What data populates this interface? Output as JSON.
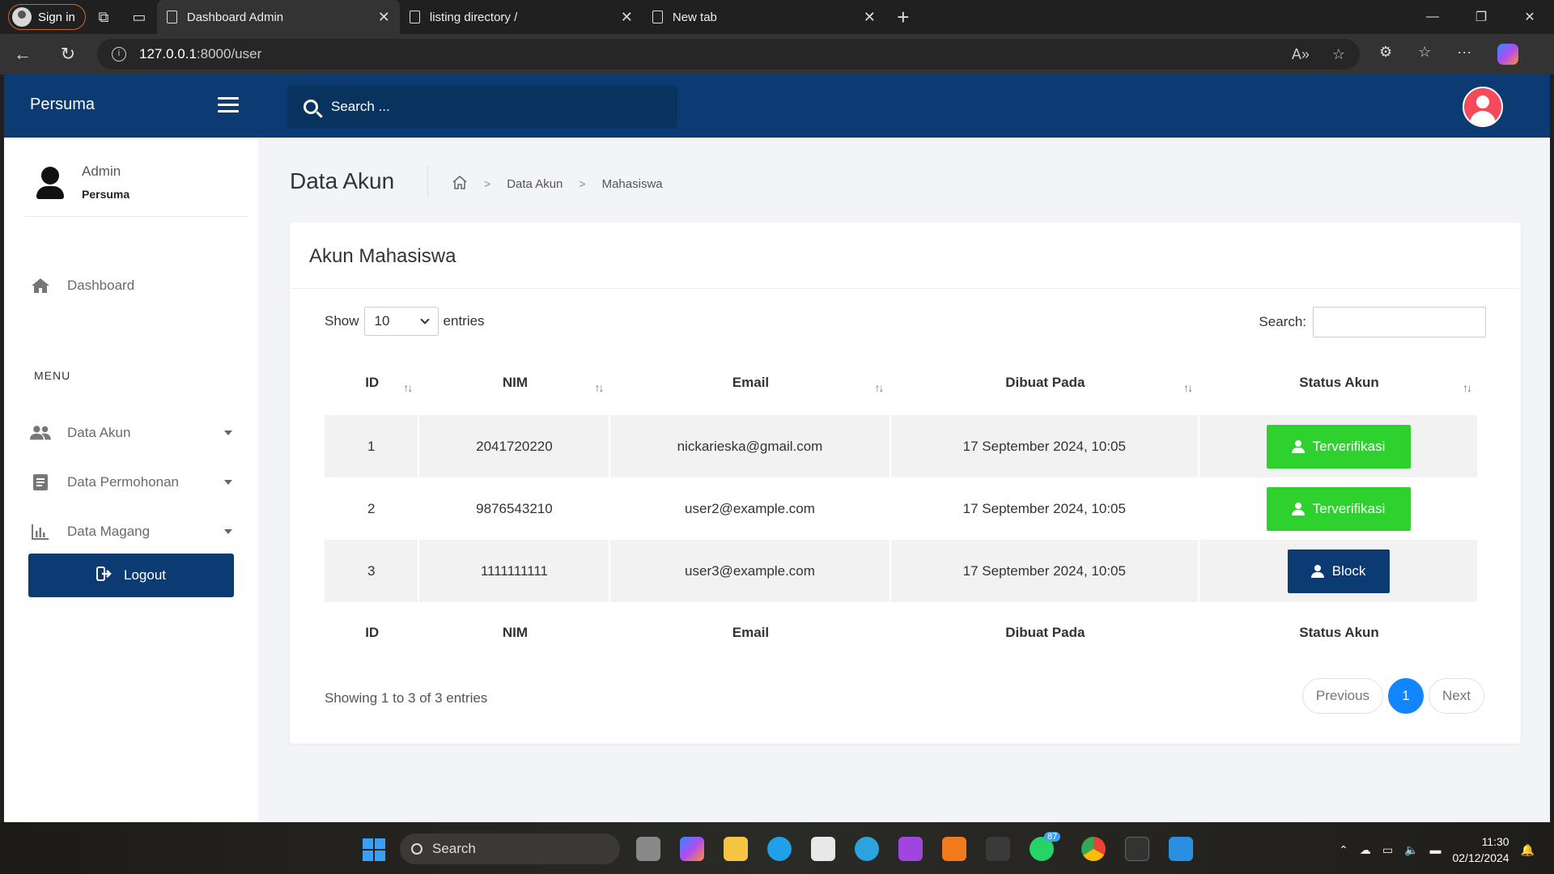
{
  "browser": {
    "signin_label": "Sign in",
    "tabs": [
      {
        "title": "Dashboard Admin",
        "active": true
      },
      {
        "title": "listing directory /",
        "active": false
      },
      {
        "title": "New tab",
        "active": false
      }
    ],
    "url_host": "127.0.0.1",
    "url_rest": ":8000/user"
  },
  "app": {
    "brand": "Persuma",
    "search_placeholder": "Search ...",
    "accent_color": "#0b3b72"
  },
  "sidebar": {
    "user_name": "Admin",
    "user_role": "Persuma",
    "dashboard_label": "Dashboard",
    "menu_label": "MENU",
    "items": [
      {
        "label": "Data Akun",
        "icon": "users-icon"
      },
      {
        "label": "Data Permohonan",
        "icon": "document-icon"
      },
      {
        "label": "Data Magang",
        "icon": "bar-chart-icon"
      }
    ],
    "logout_label": "Logout"
  },
  "page": {
    "title": "Data Akun",
    "breadcrumb": [
      "Data Akun",
      "Mahasiswa"
    ]
  },
  "card": {
    "title": "Akun Mahasiswa",
    "show_label": "Show",
    "entries_value": "10",
    "entries_label": "entries",
    "search_label": "Search:",
    "columns": [
      "ID",
      "NIM",
      "Email",
      "Dibuat Pada",
      "Status Akun"
    ],
    "rows": [
      {
        "id": "1",
        "nim": "2041720220",
        "email": "nickarieska@gmail.com",
        "created": "17 September 2024, 10:05",
        "status": "Terverifikasi",
        "status_type": "verified"
      },
      {
        "id": "2",
        "nim": "9876543210",
        "email": "user2@example.com",
        "created": "17 September 2024, 10:05",
        "status": "Terverifikasi",
        "status_type": "verified"
      },
      {
        "id": "3",
        "nim": "1111111111",
        "email": "user3@example.com",
        "created": "17 September 2024, 10:05",
        "status": "Block",
        "status_type": "blocked"
      }
    ],
    "showing_text": "Showing 1 to 3 of 3 entries",
    "pager": {
      "previous": "Previous",
      "current": "1",
      "next": "Next"
    }
  },
  "taskbar": {
    "search_label": "Search",
    "time": "11:30",
    "date": "02/12/2024",
    "badge": "87"
  }
}
